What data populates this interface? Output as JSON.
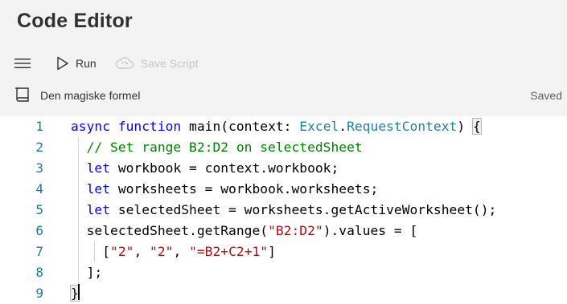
{
  "app": {
    "title": "Code Editor"
  },
  "toolbar": {
    "run_label": "Run",
    "save_label": "Save Script"
  },
  "script": {
    "name": "Den magiske formel",
    "status": "Saved"
  },
  "editor": {
    "line_numbers": [
      "1",
      "2",
      "3",
      "4",
      "5",
      "6",
      "7",
      "8",
      "9"
    ],
    "lines": [
      [
        {
          "t": "async function ",
          "c": "k"
        },
        {
          "t": "main(context: "
        },
        {
          "t": "Excel",
          "c": "t"
        },
        {
          "t": "."
        },
        {
          "t": "RequestContext",
          "c": "t"
        },
        {
          "t": ") "
        },
        {
          "t": "{",
          "c": "bm"
        }
      ],
      [
        {
          "t": "  "
        },
        {
          "t": "// Set range B2:D2 on selectedSheet",
          "c": "c"
        }
      ],
      [
        {
          "t": "  "
        },
        {
          "t": "let ",
          "c": "k"
        },
        {
          "t": "workbook = context.workbook;"
        }
      ],
      [
        {
          "t": "  "
        },
        {
          "t": "let ",
          "c": "k"
        },
        {
          "t": "worksheets = workbook.worksheets;"
        }
      ],
      [
        {
          "t": "  "
        },
        {
          "t": "let ",
          "c": "k"
        },
        {
          "t": "selectedSheet = worksheets.getActiveWorksheet();"
        }
      ],
      [
        {
          "t": "  selectedSheet.getRange("
        },
        {
          "t": "\"B2:D2\"",
          "c": "s"
        },
        {
          "t": ").values = ["
        }
      ],
      [
        {
          "t": "    ["
        },
        {
          "t": "\"2\"",
          "c": "s"
        },
        {
          "t": ", "
        },
        {
          "t": "\"2\"",
          "c": "s"
        },
        {
          "t": ", "
        },
        {
          "t": "\"=B2+C2+1\"",
          "c": "s"
        },
        {
          "t": "]"
        }
      ],
      [
        {
          "t": "  ];"
        }
      ],
      [
        {
          "t": "}",
          "c": "bm"
        }
      ]
    ]
  }
}
